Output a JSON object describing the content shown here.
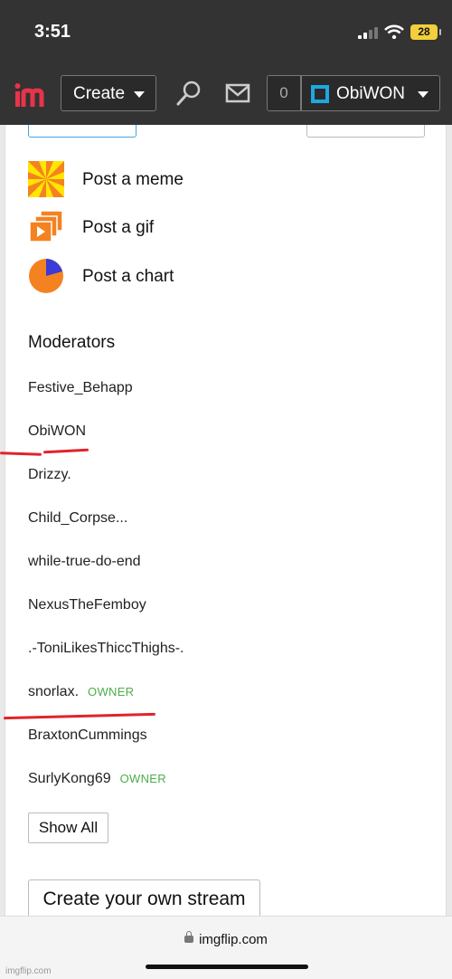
{
  "status_bar": {
    "time": "3:51",
    "battery": "28"
  },
  "header": {
    "create_label": "Create",
    "notifications_count": "0",
    "username": "ObiWON"
  },
  "post_options": [
    {
      "label": "Post a meme",
      "icon": "meme-icon"
    },
    {
      "label": "Post a gif",
      "icon": "gif-icon"
    },
    {
      "label": "Post a chart",
      "icon": "chart-icon"
    }
  ],
  "moderators": {
    "heading": "Moderators",
    "owner_badge": "OWNER",
    "list": [
      {
        "name": "Festive_Behapp"
      },
      {
        "name": "ObiWON"
      },
      {
        "name": "Drizzy."
      },
      {
        "name": "Child_Corpse..."
      },
      {
        "name": "while-true-do-end"
      },
      {
        "name": "NexusTheFemboy"
      },
      {
        "name": ".-ToniLikesThiccThighs-."
      },
      {
        "name": "snorlax.",
        "badge": "OWNER"
      },
      {
        "name": "BraxtonCummings"
      },
      {
        "name": "SurlyKong69",
        "badge": "OWNER"
      }
    ],
    "show_all_label": "Show All"
  },
  "create_stream_label": "Create your own stream",
  "browser": {
    "url": "imgflip.com"
  },
  "watermark": "imgflip.com",
  "colors": {
    "header_bg": "#333333",
    "owner_green": "#4cae4c",
    "annotation_red": "#e0242a",
    "accent_blue": "#41a5e3"
  }
}
